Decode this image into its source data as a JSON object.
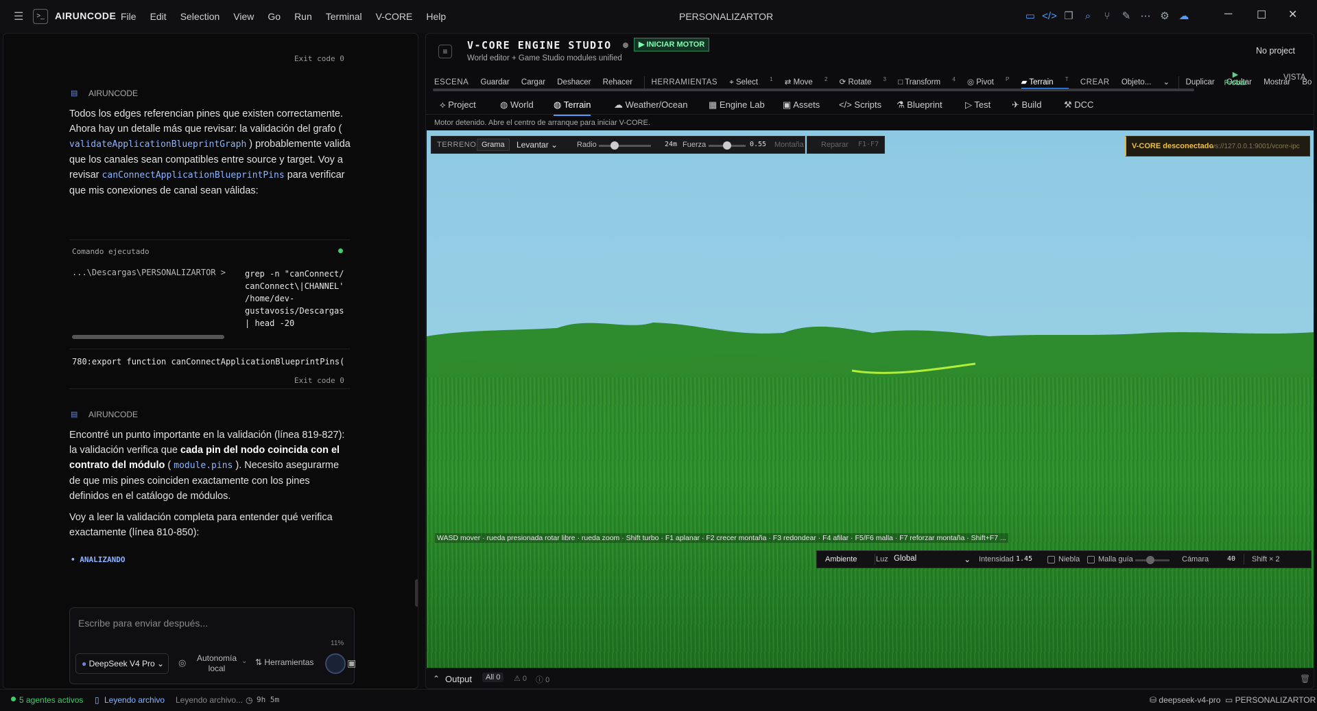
{
  "app": {
    "name": "AIRUNCODE",
    "window_title": "PERSONALIZARTOR"
  },
  "menu": [
    "File",
    "Edit",
    "Selection",
    "View",
    "Go",
    "Run",
    "Terminal",
    "V-CORE",
    "Help"
  ],
  "chat": {
    "exit_code_1": "Exit code 0",
    "author": "AIRUNCODE",
    "msg1_part1": "Todos los edges referencian pines que existen correctamente. Ahora hay un detalle más que revisar: la validación del grafo",
    "msg1_code1": "validateApplicationBlueprintGraph",
    "msg1_part2": "probablemente valida que los canales sean compatibles entre source y target. Voy a revisar",
    "msg1_code2": "canConnectApplicationBlueprintPins",
    "msg1_part3": "para verificar que mis conexiones de canal sean válidas:",
    "cmd_header": "Comando ejecutado",
    "cmd_path": "...\\Descargas\\PERSONALIZARTOR >",
    "cmd_lines": [
      "grep -n \"canConnect/",
      "canConnect\\|CHANNEL'",
      "/home/dev-",
      "gustavosis/Descargas",
      "| head -20"
    ],
    "cmd_result": "780:export function canConnectApplicationBlueprintPins(",
    "exit_code_2": "Exit code 0",
    "author2": "AIRUNCODE",
    "msg2_part1": "Encontré un punto importante en la validación (línea 819-827): la validación verifica que ",
    "msg2_bold": "cada pin del nodo coincida con el contrato del módulo",
    "msg2_code": "module.pins",
    "msg2_part2": ". Necesito asegurarme de que mis pines coinciden exactamente con los pines definidos en el catálogo de módulos.",
    "msg3": "Voy a leer la validación completa para entender qué verifica exactamente (línea 810-850):",
    "status": "ANALIZANDO",
    "input_placeholder": "Escribe para enviar después...",
    "context_pct": "11%",
    "model": "DeepSeek V4 Pro",
    "autonomy": "Autonomía local",
    "tools": "Herramientas"
  },
  "engine": {
    "title": "V-CORE ENGINE STUDIO",
    "start_btn": "▶ INICIAR MOTOR",
    "subtitle": "World editor + Game Studio modules unified",
    "project": "No project",
    "toolbar": {
      "escena": "ESCENA",
      "guardar": "Guardar",
      "cargar": "Cargar",
      "deshacer": "Deshacer",
      "rehacer": "Rehacer",
      "herramientas": "HERRAMIENTAS",
      "select": "Select",
      "select_k": "1",
      "move": "Move",
      "move_k": "2",
      "rotate": "Rotate",
      "rotate_k": "3",
      "transform": "Transform",
      "transform_k": "4",
      "pivot": "Pivot",
      "pivot_k": "P",
      "terrain": "Terrain",
      "terrain_k": "T",
      "crear": "CREAR",
      "objeto": "Objeto...",
      "duplicar": "Duplicar",
      "ocultar": "Ocultar",
      "mostrar": "Mostrar",
      "borrar": "Borrar",
      "probar": "Probar",
      "vista": "VISTA"
    },
    "tabs": [
      "Project",
      "World",
      "Terrain",
      "Weather/Ocean",
      "Engine Lab",
      "Assets",
      "Scripts",
      "Blueprint",
      "Test",
      "Build",
      "DCC"
    ],
    "active_tab": "Terrain",
    "notice": "Motor detenido. Abre el centro de arranque para iniciar V-CORE.",
    "terrain_tools": {
      "label": "TERRENO",
      "grama": "Grama",
      "mode": "Levantar",
      "radio": "Radio",
      "radio_val": "24m",
      "fuerza": "Fuerza",
      "fuerza_val": "0.55",
      "radio_level": 0.3,
      "fuerza_level": 0.5,
      "montana": "Montaña",
      "reparar": "Reparar",
      "keys": "F1-F7"
    },
    "connection": {
      "status": "V-CORE desconectado",
      "url": "ws://127.0.0.1:9001/vcore-ipc"
    },
    "hint": "WASD mover · rueda presionada rotar libre · rueda zoom · Shift turbo · F1 aplanar · F2 crecer montaña · F3 redondear · F4 afilar · F5/F6 malla · F7 reforzar montaña · Shift+F7 ...",
    "env": {
      "ambiente": "Ambiente",
      "luz": "Luz",
      "luz_val": "Global",
      "intensidad": "Intensidad",
      "intensidad_val": "1.45",
      "niebla": "Niebla",
      "malla": "Malla guía",
      "camara": "Cámara",
      "camara_val": "40",
      "shift": "Shift × 2"
    },
    "output": {
      "label": "Output",
      "all": "All 0",
      "warn": "0",
      "err": "0"
    }
  },
  "statusbar": {
    "agents": "5 agentes activos",
    "reading": "Leyendo archivo",
    "reading2": "Leyendo archivo...",
    "time": "9h 5m",
    "model": "deepseek-v4-pro",
    "project": "PERSONALIZARTOR"
  },
  "colors": {
    "accent": "#4e9cff",
    "green": "#3ecf6a",
    "warn": "#e3b341"
  }
}
